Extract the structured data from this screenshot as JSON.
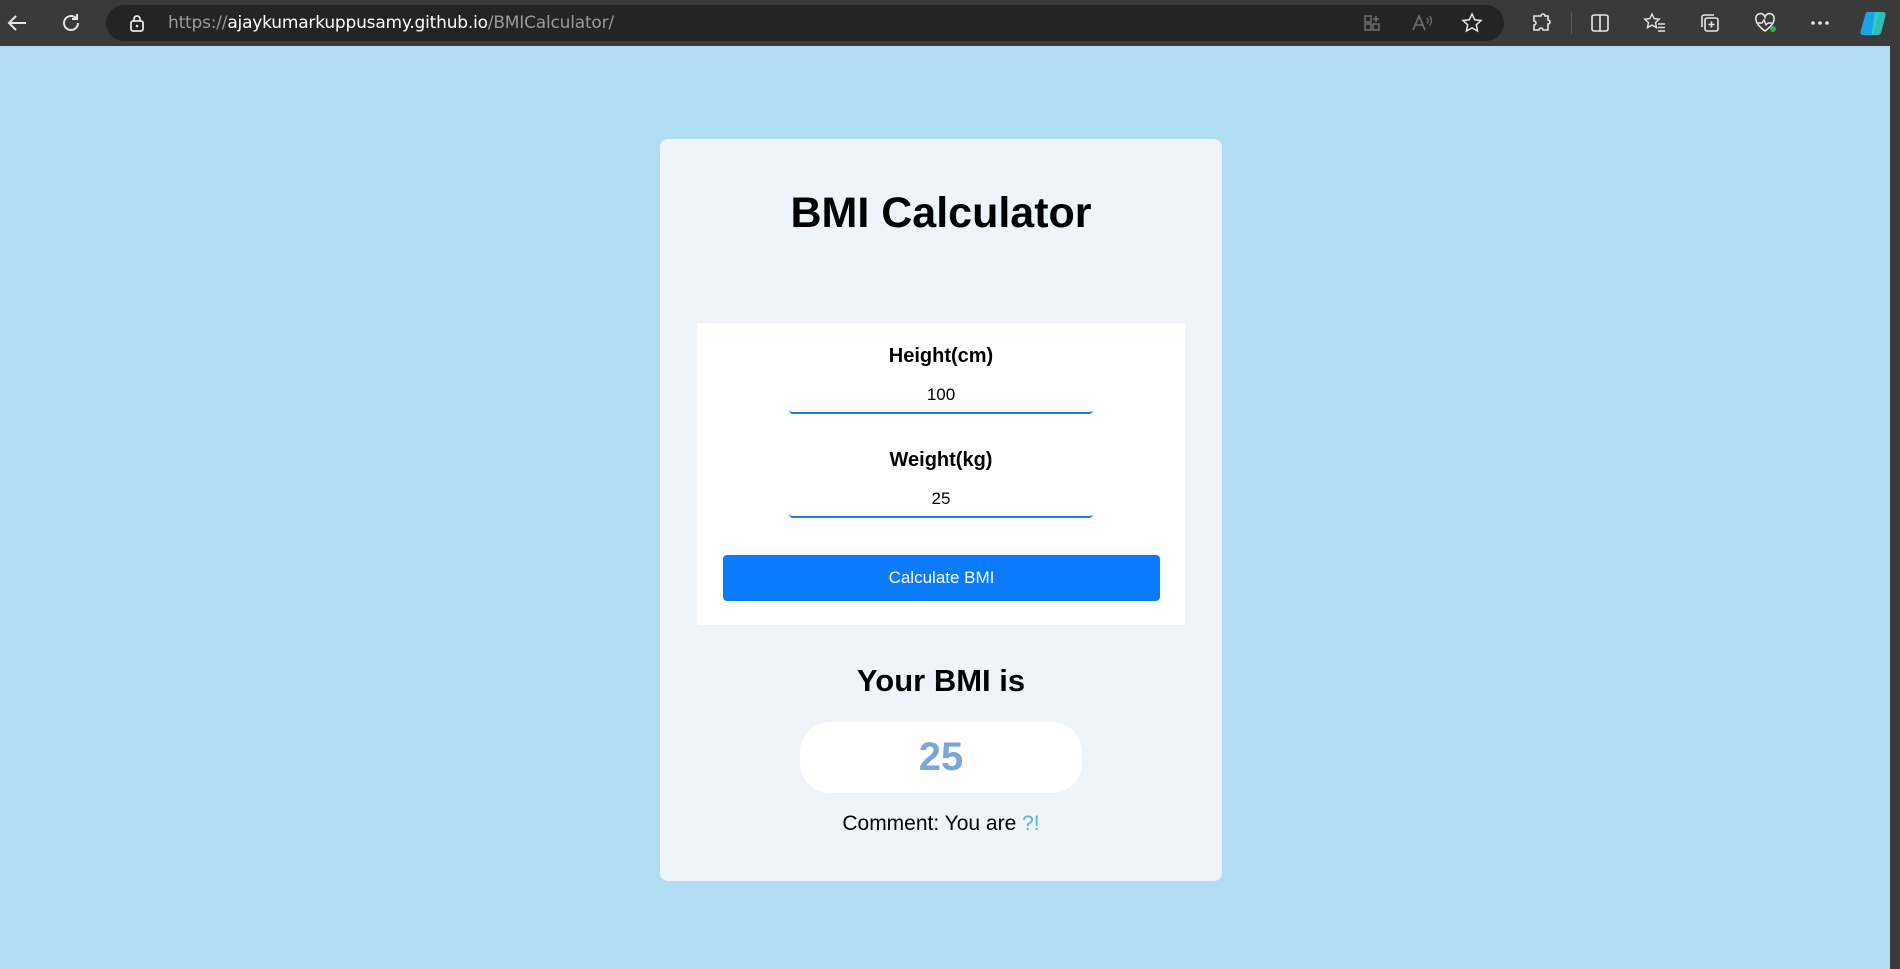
{
  "browser": {
    "url_prefix": "https://",
    "url_host": "ajaykumarkuppusamy.github.io",
    "url_path": "/BMICalculator/"
  },
  "app": {
    "title": "BMI Calculator",
    "height_label": "Height(cm)",
    "height_value": "100",
    "weight_label": "Weight(kg)",
    "weight_value": "25",
    "calculate_button": "Calculate BMI",
    "result_heading": "Your BMI is",
    "bmi_value": "25",
    "comment_prefix": "Comment: You are ",
    "comment_status": "?!"
  },
  "colors": {
    "page_background": "#b0dcf4",
    "card_background": "#eff3fa",
    "button_blue": "#0a7bfd",
    "bmi_value_color": "#7aa7d8",
    "comment_status_color": "#5dade2"
  }
}
